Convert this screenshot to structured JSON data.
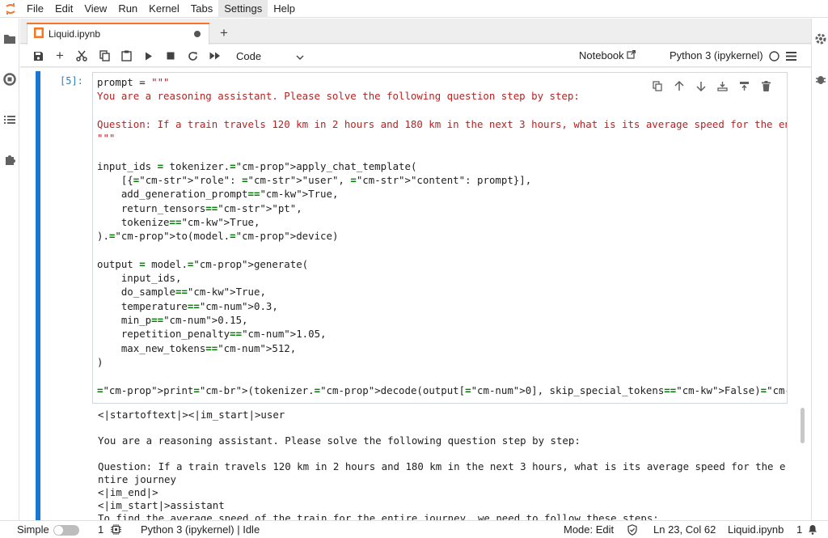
{
  "menubar": {
    "items": [
      "File",
      "Edit",
      "View",
      "Run",
      "Kernel",
      "Tabs",
      "Settings",
      "Help"
    ],
    "active": "Settings"
  },
  "tab": {
    "title": "Liquid.ipynb"
  },
  "toolbar": {
    "cell_type": "Code",
    "notebook_label": "Notebook",
    "kernel": "Python 3 (ipykernel)"
  },
  "cell": {
    "prompt": "[5]:",
    "code_lines": [
      "prompt = \"\"\"",
      "You are a reasoning assistant. Please solve the following question step by step:",
      "",
      "Question: If a train travels 120 km in 2 hours and 180 km in the next 3 hours, what is its average speed for the en",
      "\"\"\"",
      "",
      "input_ids = tokenizer.apply_chat_template(",
      "    [{\"role\": \"user\", \"content\": prompt}],",
      "    add_generation_prompt=True,",
      "    return_tensors=\"pt\",",
      "    tokenize=True,",
      ").to(model.device)",
      "",
      "output = model.generate(",
      "    input_ids,",
      "    do_sample=True,",
      "    temperature=0.3,",
      "    min_p=0.15,",
      "    repetition_penalty=1.05,",
      "    max_new_tokens=512,",
      ")",
      "",
      "print(tokenizer.decode(output[0], skip_special_tokens=False))"
    ],
    "output_lines": [
      "<|startoftext|><|im_start|>user",
      "",
      "You are a reasoning assistant. Please solve the following question step by step:",
      "",
      "Question: If a train travels 120 km in 2 hours and 180 km in the next 3 hours, what is its average speed for the e",
      "ntire journey",
      "<|im_end|>",
      "<|im_start|>assistant",
      "To find the average speed of the train for the entire journey, we need to follow these steps:"
    ]
  },
  "statusbar": {
    "mode_simple": "Simple",
    "terminals": "1",
    "kernel_status": "Python 3 (ipykernel) | Idle",
    "mode": "Mode: Edit",
    "position": "Ln 23, Col 62",
    "file": "Liquid.ipynb",
    "notifications": "1"
  },
  "colors": {
    "accent": "#1976d2",
    "tab_accent": "#f37726",
    "string": "#ba2121",
    "keyword": "#008000"
  }
}
